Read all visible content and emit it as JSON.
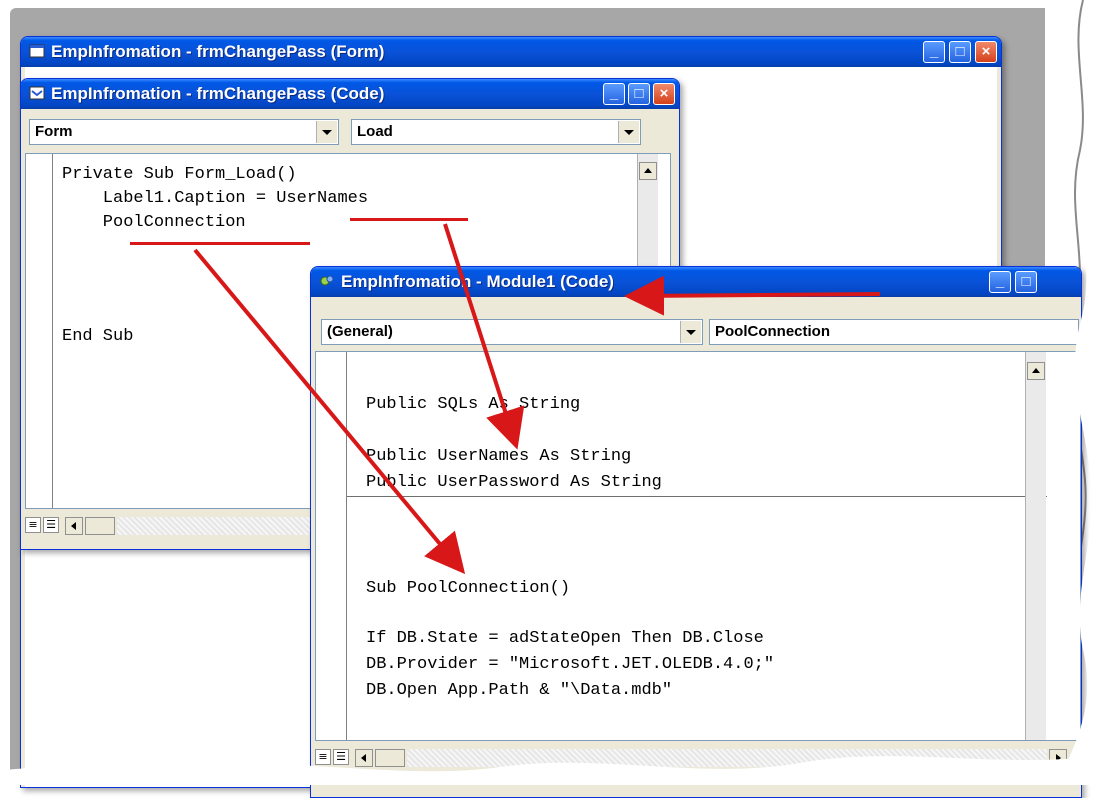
{
  "form_window": {
    "title": "EmpInfromation - frmChangePass (Form)"
  },
  "code_window": {
    "title": "EmpInfromation - frmChangePass (Code)",
    "object_combo": "Form",
    "proc_combo": "Load",
    "code_lines": [
      "Private Sub Form_Load()",
      "    Label1.Caption = UserNames",
      "    PoolConnection",
      "",
      "",
      "End Sub"
    ]
  },
  "module_window": {
    "title": "EmpInfromation - Module1 (Code)",
    "object_combo": "(General)",
    "proc_combo": "PoolConnection",
    "code_section1": [
      "Public SQLs As String",
      "",
      "Public UserNames As String",
      "Public UserPassword As String"
    ],
    "code_section2": [
      "Sub PoolConnection()",
      "",
      "If DB.State = adStateOpen Then DB.Close",
      "DB.Provider = \"Microsoft.JET.OLEDB.4.0;\"",
      "DB.Open App.Path & \"\\Data.mdb\""
    ]
  },
  "icons": [
    "window-icon",
    "code-window-icon",
    "module-icon",
    "minimize-icon",
    "maximize-icon",
    "close-icon",
    "dropdown-arrow-icon",
    "scroll-up-icon",
    "scroll-left-icon",
    "scroll-right-icon",
    "procedure-view-icon",
    "full-module-view-icon"
  ],
  "colors": {
    "titlebar": "#0a52d8",
    "annotation": "#d81818",
    "chrome": "#ece9d8"
  }
}
